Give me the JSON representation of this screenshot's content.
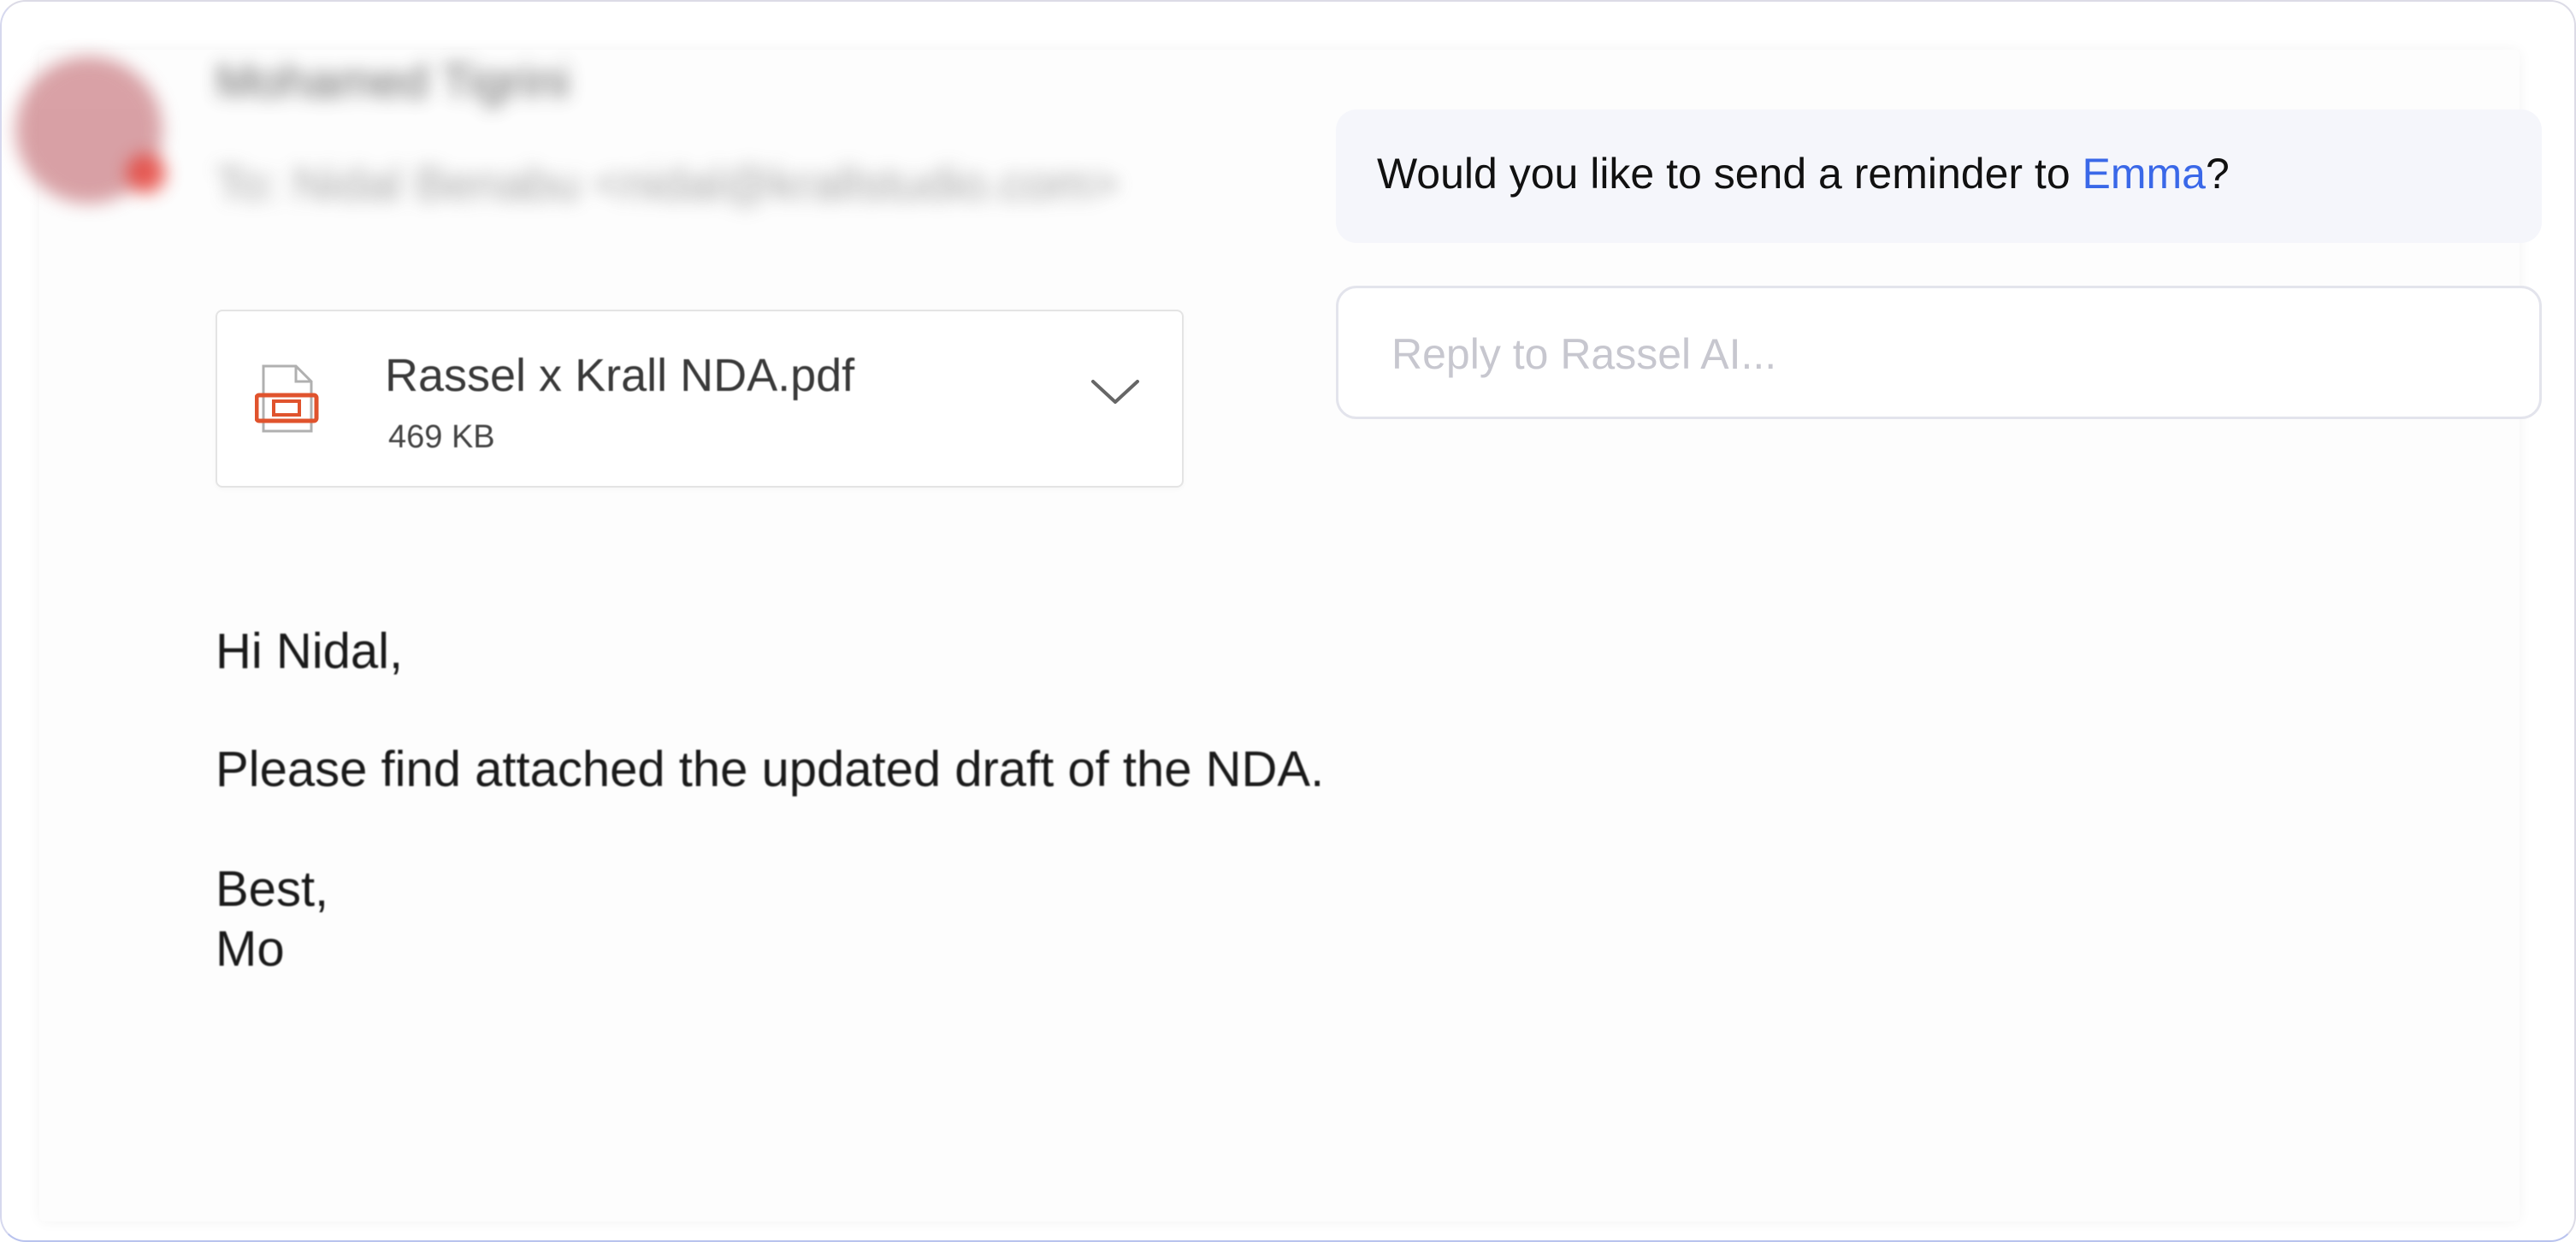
{
  "email": {
    "sender_name": "Mohamed Tigrini",
    "recipient_line": "To: Nidal Benabu <nidal@krallstudio.com>",
    "attachment": {
      "file_name": "Rassel x Krall NDA.pdf",
      "file_size": "469 KB",
      "icon": "pdf-file-icon",
      "icon_color": "#e0532d"
    },
    "body": {
      "greeting": "Hi Nidal,",
      "message": "Please find attached the updated draft of the NDA.",
      "closing": "Best,",
      "signature": "Mo"
    }
  },
  "assistant": {
    "prompt_prefix": "Would you like to send a reminder to ",
    "prompt_name": "Emma",
    "prompt_suffix": "?",
    "highlight_color": "#3a68e8",
    "reply_placeholder": "Reply to Rassel AI...",
    "reply_value": ""
  }
}
